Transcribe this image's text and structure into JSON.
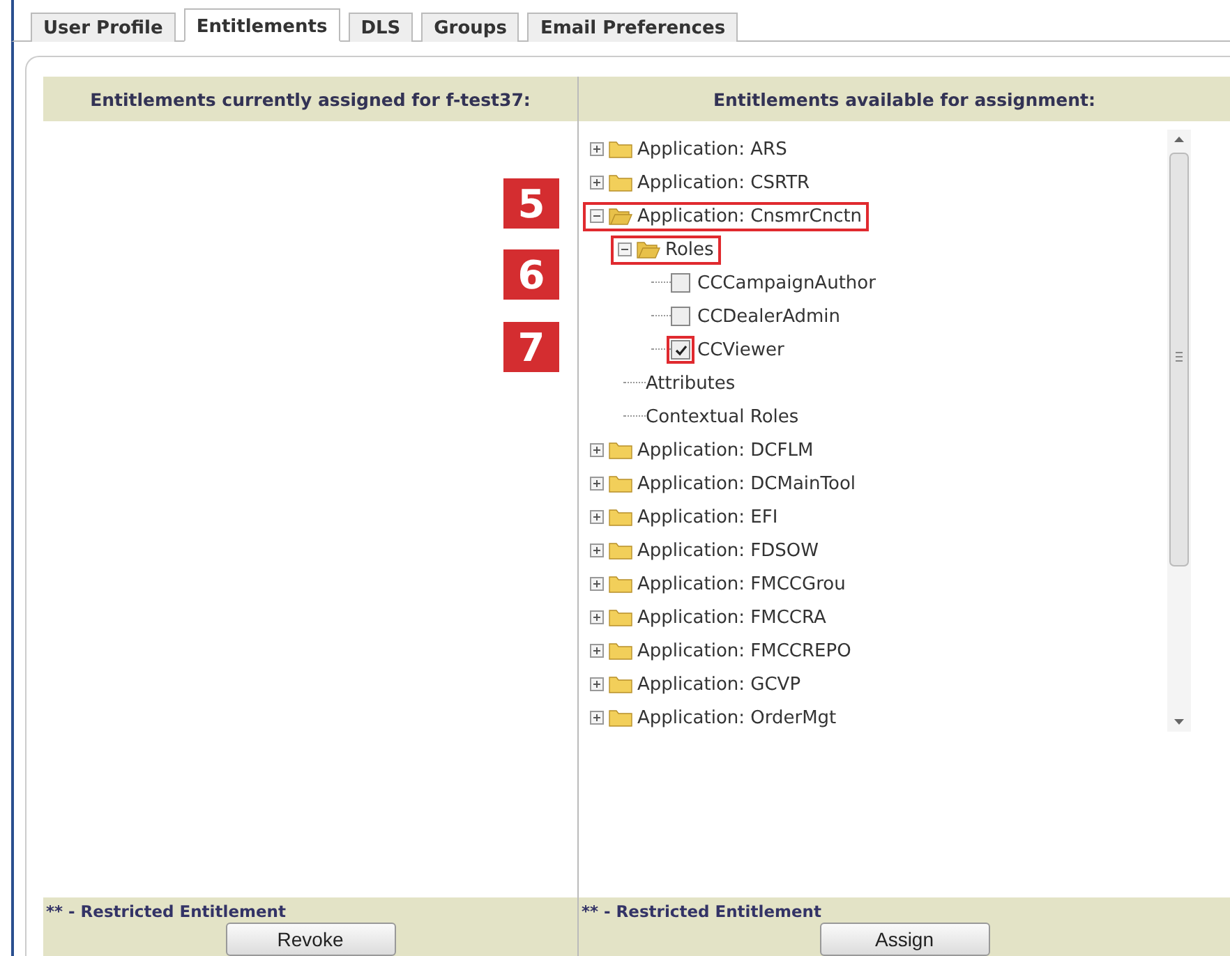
{
  "tabs": [
    {
      "label": "User Profile",
      "selected": false
    },
    {
      "label": "Entitlements",
      "selected": true
    },
    {
      "label": "DLS",
      "selected": false
    },
    {
      "label": "Groups",
      "selected": false
    },
    {
      "label": "Email Preferences",
      "selected": false
    }
  ],
  "left_panel": {
    "header": "Entitlements currently assigned for f-test37:",
    "footer_note": "** - Restricted Entitlement",
    "button": "Revoke"
  },
  "right_panel": {
    "header": "Entitlements available for assignment:",
    "footer_note": "** - Restricted Entitlement",
    "button": "Assign",
    "tree": [
      {
        "kind": "folder",
        "label": "Application: ARS",
        "expanded": false,
        "highlighted": false
      },
      {
        "kind": "folder",
        "label": "Application: CSRTR",
        "expanded": false,
        "highlighted": false
      },
      {
        "kind": "folder",
        "label": "Application: CnsmrCnctn",
        "expanded": true,
        "highlighted": true,
        "callout": "5",
        "children": [
          {
            "kind": "folder",
            "label": "Roles",
            "expanded": true,
            "highlighted": true,
            "callout": "6",
            "children": [
              {
                "kind": "checkbox",
                "label": "CCCampaignAuthor",
                "checked": false,
                "highlighted": false
              },
              {
                "kind": "checkbox",
                "label": "CCDealerAdmin",
                "checked": false,
                "highlighted": false
              },
              {
                "kind": "checkbox",
                "label": "CCViewer",
                "checked": true,
                "highlighted": true,
                "callout": "7"
              }
            ]
          },
          {
            "kind": "leaf",
            "label": "Attributes",
            "highlighted": false
          },
          {
            "kind": "leaf",
            "label": "Contextual Roles",
            "highlighted": false
          }
        ]
      },
      {
        "kind": "folder",
        "label": "Application: DCFLM",
        "expanded": false,
        "highlighted": false
      },
      {
        "kind": "folder",
        "label": "Application: DCMainTool",
        "expanded": false,
        "highlighted": false
      },
      {
        "kind": "folder",
        "label": "Application: EFI",
        "expanded": false,
        "highlighted": false
      },
      {
        "kind": "folder",
        "label": "Application: FDSOW",
        "expanded": false,
        "highlighted": false
      },
      {
        "kind": "folder",
        "label": "Application: FMCCGrou",
        "expanded": false,
        "highlighted": false
      },
      {
        "kind": "folder",
        "label": "Application: FMCCRA",
        "expanded": false,
        "highlighted": false
      },
      {
        "kind": "folder",
        "label": "Application: FMCCREPO",
        "expanded": false,
        "highlighted": false
      },
      {
        "kind": "folder",
        "label": "Application: GCVP",
        "expanded": false,
        "highlighted": false
      },
      {
        "kind": "folder",
        "label": "Application: OrderMgt",
        "expanded": false,
        "highlighted": false
      }
    ]
  }
}
